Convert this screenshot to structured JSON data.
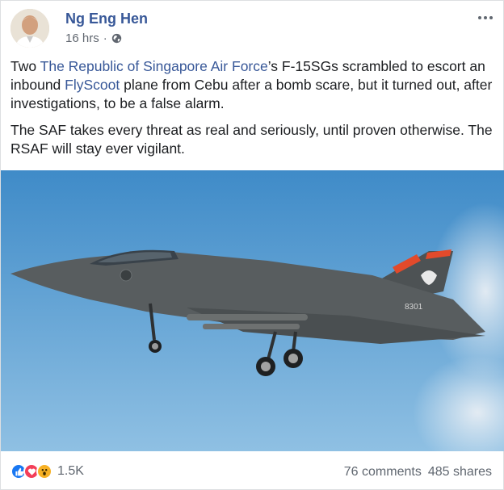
{
  "post": {
    "author": "Ng Eng Hen",
    "time": "16 hrs",
    "privacy_icon": "globe-icon",
    "para1": {
      "t1": "Two ",
      "link1": "The Republic of Singapore Air Force",
      "t2": "’s F-15SGs scrambled to escort an inbound ",
      "link2": "FlyScoot",
      "t3": " plane from Cebu after a bomb scare, but it turned out, after investigations, to be a false alarm."
    },
    "para2": "The SAF takes every threat as real and seriously, until proven otherwise. The RSAF will stay ever vigilant.",
    "photo": {
      "tail_number": "8301"
    }
  },
  "footer": {
    "reactions": [
      "like-icon",
      "love-icon",
      "wow-icon"
    ],
    "reaction_count": "1.5K",
    "comments": "76 comments",
    "shares": "485 shares"
  },
  "colors": {
    "link": "#385898",
    "secondary_text": "#616770",
    "sky_top": "#3f8bc8",
    "sky_bottom": "#8fc0e3"
  }
}
